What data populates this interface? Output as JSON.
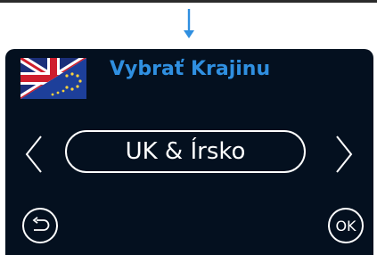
{
  "screen": {
    "title": "Vybrať Krajinu",
    "selected_region": "UK & Írsko",
    "ok_label": "OK",
    "accent_color": "#2f8fe0",
    "background_color": "#04101f"
  },
  "icons": {
    "down_arrow": "arrow-down-icon",
    "flag": "uk-eu-flag-icon",
    "previous": "chevron-left-icon",
    "next": "chevron-right-icon",
    "back": "back-arrow-icon"
  }
}
